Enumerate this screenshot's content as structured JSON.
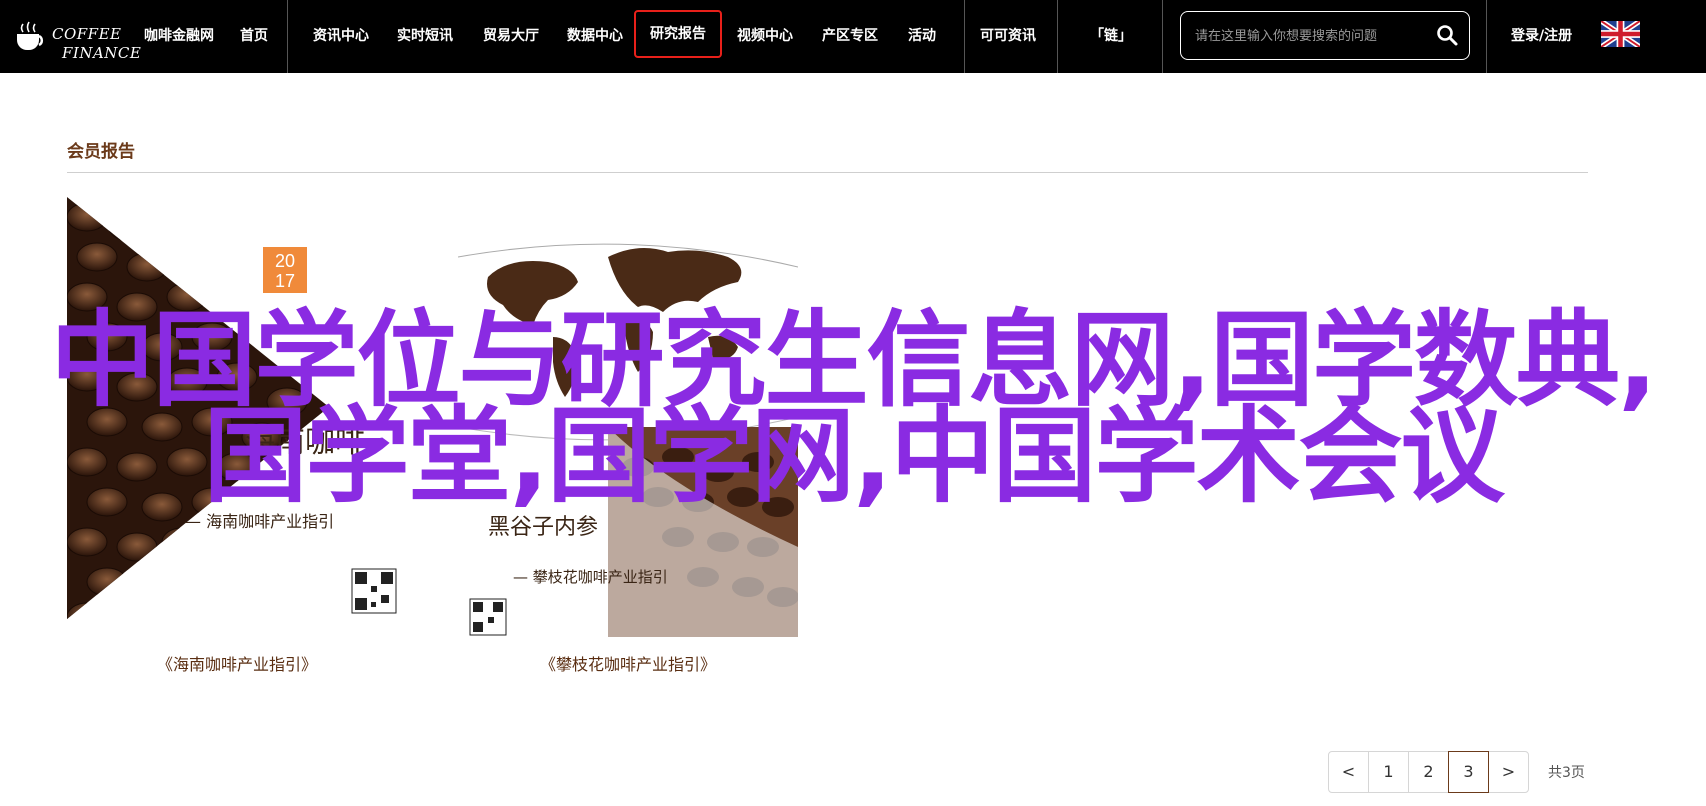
{
  "logo": {
    "line1": "COFFEE",
    "line2": "FINANCE"
  },
  "nav": {
    "items": [
      "咖啡金融网",
      "首页",
      "资讯中心",
      "实时短讯",
      "贸易大厅",
      "数据中心",
      "研究报告",
      "视频中心",
      "产区专区",
      "活动",
      "可可资讯",
      "「链」"
    ],
    "login": "登录/注册"
  },
  "search": {
    "placeholder": "请在这里输入你想要搜索的问题"
  },
  "section": {
    "title": "会员报告"
  },
  "reports": [
    {
      "caption": "《海南咖啡产业指引》",
      "year_top": "20",
      "year_bottom": "17",
      "cover_title": "海南咖啡",
      "cover_subtitle": "— 海南咖啡产业指引"
    },
    {
      "caption": "《攀枝花咖啡产业指引》",
      "cover_title": "黑谷子内参",
      "cover_subtitle": "— 攀枝花咖啡产业指引"
    }
  ],
  "overlay": {
    "text": "中国学位与研究生信息网,国学数典,国学堂,国学网,中国学术会议"
  },
  "pagination": {
    "prev": "<",
    "pages": [
      "1",
      "2",
      "3"
    ],
    "current": "3",
    "next": ">",
    "total": "共3页"
  },
  "colors": {
    "accent_brown": "#6b3a1a",
    "overlay_purple": "#8a2be2",
    "active_outline": "#e8201a"
  }
}
